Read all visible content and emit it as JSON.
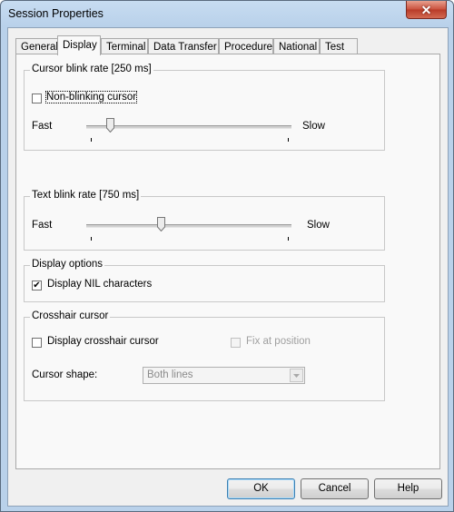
{
  "window": {
    "title": "Session Properties",
    "close_label": "✕"
  },
  "tabs": [
    {
      "label": "General",
      "active": false
    },
    {
      "label": "Display",
      "active": true
    },
    {
      "label": "Terminal",
      "active": false
    },
    {
      "label": "Data Transfer",
      "active": false
    },
    {
      "label": "Procedure",
      "active": false
    },
    {
      "label": "National",
      "active": false
    },
    {
      "label": "Test",
      "active": false
    }
  ],
  "cursor_blink": {
    "group_label": "Cursor blink rate [250 ms]",
    "non_blinking_label": "Non-blinking cursor",
    "non_blinking_checked": false,
    "fast_label": "Fast",
    "slow_label": "Slow",
    "value_fraction": 0.1
  },
  "text_blink": {
    "group_label": "Text blink rate [750 ms]",
    "fast_label": "Fast",
    "slow_label": "Slow",
    "value_fraction": 0.36
  },
  "display_options": {
    "group_label": "Display options",
    "nil_label": "Display NIL characters",
    "nil_checked": true
  },
  "crosshair": {
    "group_label": "Crosshair cursor",
    "display_label": "Display crosshair cursor",
    "display_checked": false,
    "fix_label": "Fix at position",
    "fix_checked": false,
    "fix_enabled": false,
    "shape_label": "Cursor shape:",
    "shape_value": "Both lines"
  },
  "buttons": {
    "ok": "OK",
    "cancel": "Cancel",
    "help": "Help"
  }
}
